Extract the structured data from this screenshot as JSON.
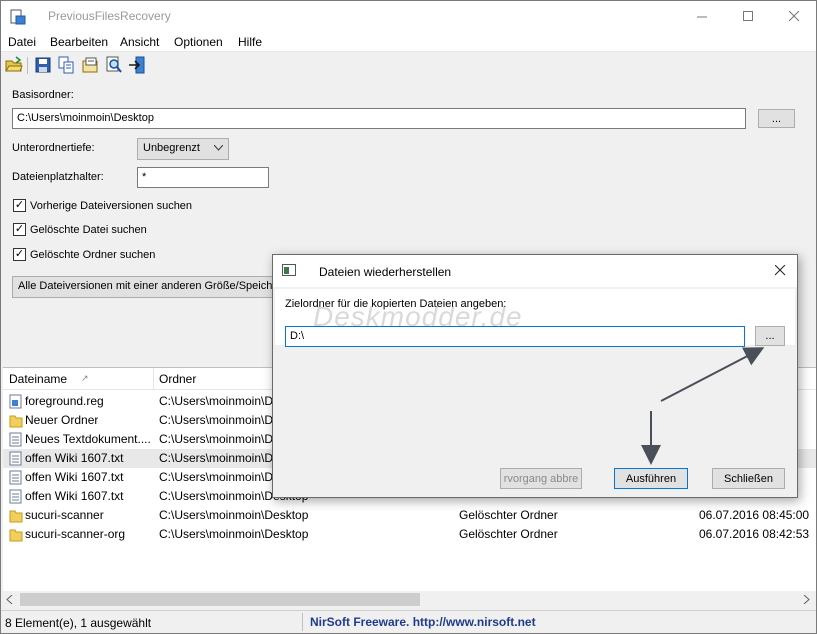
{
  "window": {
    "title": "PreviousFilesRecovery"
  },
  "menu": [
    "Datei",
    "Bearbeiten",
    "Ansicht",
    "Optionen",
    "Hilfe"
  ],
  "toolbar": {
    "icons": [
      "open-folder-icon",
      "save-icon",
      "copy-icon",
      "properties-icon",
      "find-icon",
      "exit-icon"
    ]
  },
  "form": {
    "base_label": "Basisordner:",
    "base_value": "C:\\Users\\moinmoin\\Desktop",
    "browse_label": "...",
    "subdepth_label": "Unterordnertiefe:",
    "subdepth_value": "Unbegrenzt",
    "wildcard_label": "Dateienplatzhalter:",
    "wildcard_value": "*",
    "check_prev_versions": "Vorherige Dateiversionen suchen",
    "check_deleted_files": "Gelöschte Datei suchen",
    "check_deleted_folders": "Gelöschte Ordner suchen",
    "filter_value": "Alle Dateiversionen mit einer anderen Größe/Speicher"
  },
  "list": {
    "columns": [
      "Dateiname",
      "Ordner"
    ],
    "rows": [
      {
        "name": "foreground.reg",
        "folder": "C:\\Users\\moinmoin\\D",
        "type": "",
        "date": ""
      },
      {
        "name": "Neuer Ordner",
        "folder": "C:\\Users\\moinmoin\\D",
        "type": "",
        "date": ""
      },
      {
        "name": "Neues Textdokument....",
        "folder": "C:\\Users\\moinmoin\\D",
        "type": "",
        "date": ""
      },
      {
        "name": "offen Wiki 1607.txt",
        "folder": "C:\\Users\\moinmoin\\D",
        "type": "",
        "date": ""
      },
      {
        "name": "offen Wiki 1607.txt",
        "folder": "C:\\Users\\moinmoin\\D",
        "type": "",
        "date": ""
      },
      {
        "name": "offen Wiki 1607.txt",
        "folder": "C:\\Users\\moinmoin\\Desktop",
        "type": "",
        "date": ""
      },
      {
        "name": "sucuri-scanner",
        "folder": "C:\\Users\\moinmoin\\Desktop",
        "type": "Gelöschter Ordner",
        "date": "06.07.2016 08:45:00"
      },
      {
        "name": "sucuri-scanner-org",
        "folder": "C:\\Users\\moinmoin\\Desktop",
        "type": "Gelöschter Ordner",
        "date": "06.07.2016 08:42:53"
      }
    ]
  },
  "status": {
    "count": "8 Element(e), 1 ausgewählt",
    "credit": "NirSoft Freeware.  http://www.nirsoft.net"
  },
  "dialog": {
    "title": "Dateien wiederherstellen",
    "prompt": "Zielordner für die kopierten Dateien angeben:",
    "path_value": "D:\\",
    "browse_label": "...",
    "abort_label": "rvorgang abbre",
    "run_label": "Ausführen",
    "close_label": "Schließen"
  },
  "watermark": "Deskmodder.de",
  "colors": {
    "link": "#1f3c8c",
    "accent": "#0078d7",
    "arrow": "#4a4f5a"
  }
}
